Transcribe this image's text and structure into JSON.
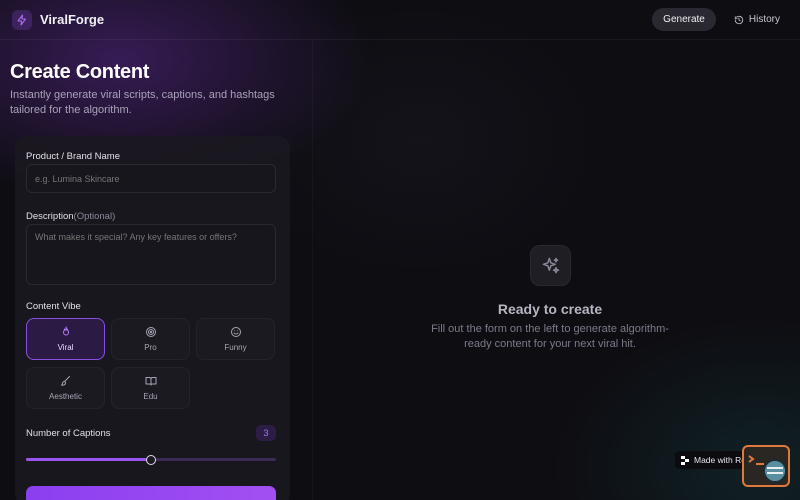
{
  "app": {
    "name": "ViralForge"
  },
  "nav": {
    "generate_label": "Generate",
    "history_label": "History"
  },
  "page": {
    "title": "Create Content",
    "subtitle": "Instantly generate viral scripts, captions, and hashtags tailored for the algorithm."
  },
  "form": {
    "product_label": "Product / Brand Name",
    "product_placeholder": "e.g. Lumina Skincare",
    "product_value": "",
    "description_label": "Description",
    "description_optional": "(Optional)",
    "description_placeholder": "What makes it special? Any key features or offers?",
    "description_value": "",
    "vibe_label": "Content Vibe",
    "vibes": [
      {
        "label": "Viral",
        "icon": "flame-icon",
        "selected": true
      },
      {
        "label": "Pro",
        "icon": "target-icon",
        "selected": false
      },
      {
        "label": "Funny",
        "icon": "smile-icon",
        "selected": false
      },
      {
        "label": "Aesthetic",
        "icon": "brush-icon",
        "selected": false
      },
      {
        "label": "Edu",
        "icon": "book-icon",
        "selected": false
      }
    ],
    "captions_label": "Number of Captions",
    "captions_count": "3",
    "captions_slider_fraction": 0.5
  },
  "empty_state": {
    "title": "Ready to create",
    "text": "Fill out the form on the left to generate algorithm-ready content for your next viral hit."
  },
  "footer": {
    "replit_badge": "Made with Replit"
  },
  "colors": {
    "accent": "#9a55f0",
    "background": "#0e0d12",
    "card": "#1a1820"
  }
}
